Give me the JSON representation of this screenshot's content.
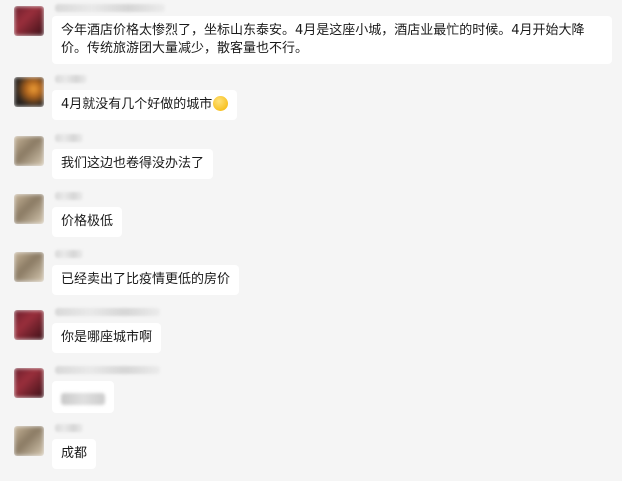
{
  "messages": [
    {
      "text": "今年酒店价格太惨烈了，坐标山东泰安。4月是这座小城，酒店业最忙的时候。4月开始大降价。传统旅游团大量减少，散客量也不行。"
    },
    {
      "text": "4月就没有几个好做的城市",
      "icon": "sweat-smile-emoji-icon"
    },
    {
      "text": "我们这边也卷得没办法了"
    },
    {
      "text": "价格极低"
    },
    {
      "text": "已经卖出了比疫情更低的房价"
    },
    {
      "text": "你是哪座城市啊"
    },
    {
      "text": ""
    },
    {
      "text": "成都"
    }
  ],
  "colors": {
    "background": "#f5f5f5",
    "bubble": "#ffffff",
    "text": "#1a1a1a"
  }
}
